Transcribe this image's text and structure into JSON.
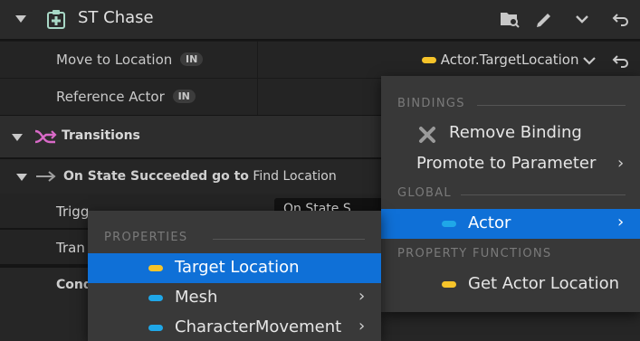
{
  "header": {
    "title": "ST Chase"
  },
  "rows": {
    "move_label": "Move to Location",
    "move_badge": "IN",
    "move_binding": "Actor.TargetLocation",
    "ref_label": "Reference Actor",
    "ref_badge": "IN"
  },
  "transitions": {
    "label": "Transitions",
    "state_bold": "On State Succeeded go to",
    "state_target": "Find Location",
    "trigger_label": "Trigg",
    "trigger_value": "On State S",
    "tran_label": "Tran",
    "cond_label": "Cond"
  },
  "bindings_menu": {
    "section_bindings": "BINDINGS",
    "remove_binding": "Remove Binding",
    "promote": "Promote to Parameter",
    "section_global": "GLOBAL",
    "actor": "Actor",
    "section_property_functions": "PROPERTY FUNCTIONS",
    "get_actor_location": "Get Actor Location"
  },
  "properties_menu": {
    "section_properties": "PROPERTIES",
    "target_location": "Target Location",
    "mesh": "Mesh",
    "character_movement": "CharacterMovement"
  },
  "colors": {
    "selection": "#0f70d7",
    "vector_pin": "#f6c42a",
    "object_pin": "#1fa7e8"
  }
}
